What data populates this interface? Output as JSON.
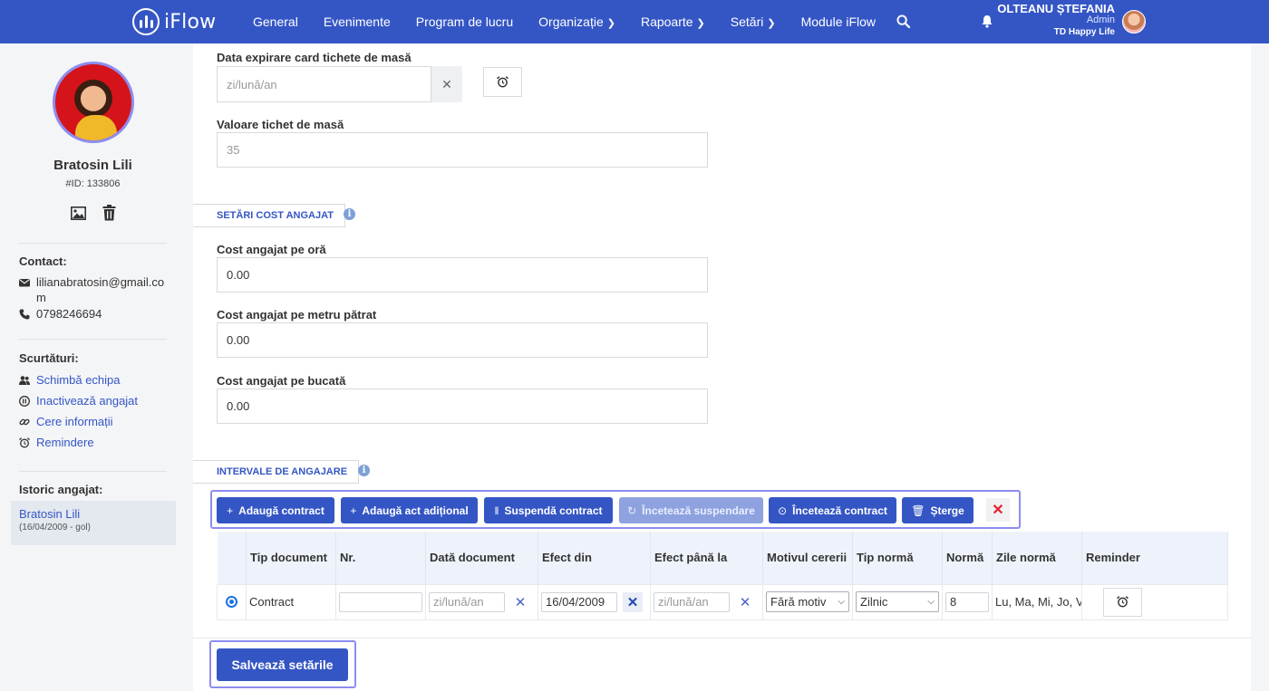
{
  "app": {
    "brand": "iFlow"
  },
  "nav": [
    {
      "label": "General",
      "has_chevron": false
    },
    {
      "label": "Evenimente",
      "has_chevron": false
    },
    {
      "label": "Program de lucru",
      "has_chevron": false
    },
    {
      "label": "Organizație",
      "has_chevron": true
    },
    {
      "label": "Rapoarte",
      "has_chevron": true
    },
    {
      "label": "Setări",
      "has_chevron": true
    },
    {
      "label": "Module iFlow",
      "has_chevron": false
    }
  ],
  "user": {
    "name": "OLTEANU ȘTEFANIA",
    "role": "Admin",
    "company": "TD Happy Life"
  },
  "employee": {
    "name": "Bratosin Lili",
    "id_label": "#ID: 133806",
    "contact_heading": "Contact:",
    "email": "lilianabratosin@gmail.com",
    "phone": "0798246694",
    "shortcuts_heading": "Scurtături:",
    "shortcuts": [
      {
        "label": "Schimbă echipa",
        "icon": "users-icon"
      },
      {
        "label": "Inactivează angajat",
        "icon": "pause-circle-icon"
      },
      {
        "label": "Cere informații",
        "icon": "link-icon"
      },
      {
        "label": "Remindere",
        "icon": "alarm-clock-icon"
      }
    ],
    "history_heading": "Istoric angajat:",
    "history": {
      "name": "Bratosin Lili",
      "dates": "(16/04/2009 - gol)"
    }
  },
  "form": {
    "meal_card_expiry": {
      "label": "Data expirare card tichete de masă",
      "placeholder": "zi/lună/an",
      "value": ""
    },
    "meal_ticket_value": {
      "label": "Valoare tichet de masă",
      "value": "35"
    },
    "cost_section": {
      "title": "SETĂRI COST ANGAJAT"
    },
    "cost_per_hour": {
      "label": "Cost angajat pe oră",
      "value": "0.00"
    },
    "cost_per_sqm": {
      "label": "Cost angajat pe metru pătrat",
      "value": "0.00"
    },
    "cost_per_piece": {
      "label": "Cost angajat pe bucată",
      "value": "0.00"
    },
    "intervals_section": {
      "title": "INTERVALE DE ANGAJARE"
    }
  },
  "toolbar": {
    "add_contract": "Adaugă contract",
    "add_addendum": "Adaugă act adițional",
    "suspend_contract": "Suspendă contract",
    "end_suspension": "Încetează suspendare",
    "end_contract": "Încetează contract",
    "delete": "Șterge"
  },
  "table": {
    "headers": [
      "",
      "Tip document",
      "Nr.",
      "Dată document",
      "Efect din",
      "Efect până la",
      "Motivul cererii",
      "Tip normă",
      "Normă",
      "Zile normă",
      "Reminder"
    ],
    "row": {
      "selected": true,
      "doc_type": "Contract",
      "number": "",
      "doc_date_placeholder": "zi/lună/an",
      "effect_from": "16/04/2009",
      "effect_until_placeholder": "zi/lună/an",
      "reason": "Fără motiv",
      "norm_type": "Zilnic",
      "norm": "8",
      "norm_days": "Lu, Ma, Mi, Jo, Vi"
    }
  },
  "save": {
    "label": "Salvează setările"
  },
  "colors": {
    "primary": "#3456c5",
    "highlight_frame": "#8d8cf0",
    "danger": "#e5222e"
  }
}
